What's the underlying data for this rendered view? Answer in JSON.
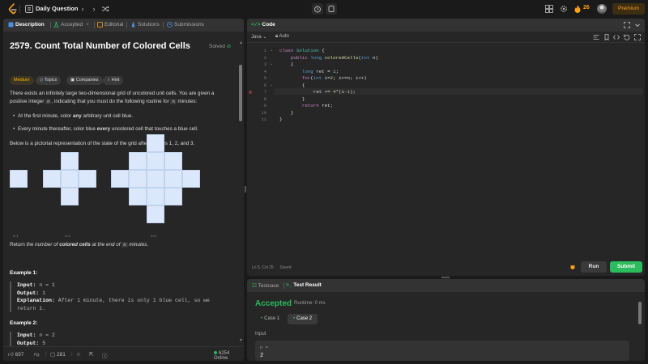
{
  "topbar": {
    "title": "Daily Question",
    "streak": "26",
    "premium": "Premium"
  },
  "left": {
    "tabs": [
      {
        "label": "Description"
      },
      {
        "label": "Accepted"
      },
      {
        "label": "Editorial"
      },
      {
        "label": "Solutions"
      },
      {
        "label": "Submissions"
      }
    ],
    "title": "2579. Count Total Number of Colored Cells",
    "solved": "Solved",
    "pills": [
      "Medium",
      "Topics",
      "Companies",
      "Hint"
    ],
    "p1a": "There exists an infinitely large two-dimensional grid of uncolored unit cells. You are given a",
    "p1b": "positive integer",
    "p1_var": "n",
    "p1c": ", indicating that you must do the following routine for",
    "p1_var2": "n",
    "p1d": "minutes:",
    "b1a": "At the first minute, color",
    "b1b": "any",
    "b1c": "arbitrary unit cell blue.",
    "b2a": "Every minute thereafter, color blue",
    "b2b": "every",
    "b2c": "uncolored cell that touches a blue cell.",
    "p2": "Below is a pictorial representation of the state of the grid after minutes 1, 2, and 3.",
    "grid_labels": [
      "n=1",
      "n=2",
      "n=3"
    ],
    "p3a": "Return",
    "p3b": "the number of",
    "p3c": "colored cells",
    "p3d": "at the end of",
    "p3_var": "n",
    "p3e": "minutes",
    "ex1_title": "Example 1:",
    "ex1_input_label": "Input:",
    "ex1_input": "n = 1",
    "ex1_output_label": "Output:",
    "ex1_output": "1",
    "ex1_expl_label": "Explanation:",
    "ex1_expl": "After 1 minute, there is only 1 blue cell, so we",
    "ex1_expl2": "return 1.",
    "ex2_title": "Example 2:",
    "ex2_input_label": "Input:",
    "ex2_input": "n = 2",
    "ex2_output_label": "Output:",
    "ex2_output": "5",
    "footer": {
      "likes": "697",
      "comments": "281",
      "online": "6254 Online"
    }
  },
  "code": {
    "title": "Code",
    "language": "Java",
    "auto": "Auto",
    "status": "Ln 5, Col 25",
    "saved": "Saved",
    "run": "Run",
    "submit": "Submit",
    "line_numbers": [
      "1",
      "2",
      "3",
      "4",
      "5",
      "6",
      "7",
      "8",
      "9",
      "10",
      "11"
    ]
  },
  "result": {
    "tab_testcase": "Testcase",
    "tab_result": "Test Result",
    "accepted": "Accepted",
    "runtime": "Runtime: 0 ms",
    "case1": "Case 1",
    "case2": "Case 2",
    "input_label": "Input",
    "input_var": "n =",
    "input_val": "2"
  }
}
